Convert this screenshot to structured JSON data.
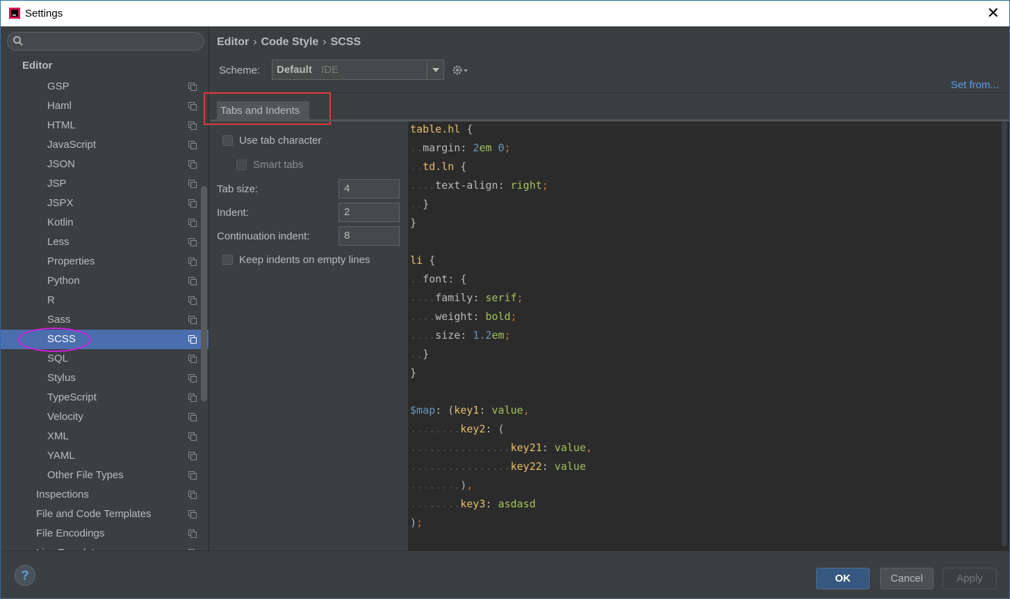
{
  "window": {
    "title": "Settings"
  },
  "sidebar": {
    "search_placeholder": "",
    "section": "Editor",
    "items": [
      {
        "label": "GSP",
        "level": 2
      },
      {
        "label": "Haml",
        "level": 2
      },
      {
        "label": "HTML",
        "level": 2
      },
      {
        "label": "JavaScript",
        "level": 2
      },
      {
        "label": "JSON",
        "level": 2
      },
      {
        "label": "JSP",
        "level": 2
      },
      {
        "label": "JSPX",
        "level": 2
      },
      {
        "label": "Kotlin",
        "level": 2
      },
      {
        "label": "Less",
        "level": 2
      },
      {
        "label": "Properties",
        "level": 2
      },
      {
        "label": "Python",
        "level": 2
      },
      {
        "label": "R",
        "level": 2
      },
      {
        "label": "Sass",
        "level": 2
      },
      {
        "label": "SCSS",
        "level": 2,
        "selected": true
      },
      {
        "label": "SQL",
        "level": 2
      },
      {
        "label": "Stylus",
        "level": 2
      },
      {
        "label": "TypeScript",
        "level": 2
      },
      {
        "label": "Velocity",
        "level": 2
      },
      {
        "label": "XML",
        "level": 2
      },
      {
        "label": "YAML",
        "level": 2
      },
      {
        "label": "Other File Types",
        "level": 2
      },
      {
        "label": "Inspections",
        "level": 1
      },
      {
        "label": "File and Code Templates",
        "level": 1
      },
      {
        "label": "File Encodings",
        "level": 1
      },
      {
        "label": "Live Templates",
        "level": 1
      }
    ]
  },
  "breadcrumb": [
    "Editor",
    "Code Style",
    "SCSS"
  ],
  "breadcrumb_sep": "›",
  "scheme": {
    "label": "Scheme:",
    "value": "Default",
    "sub": "IDE"
  },
  "set_from": "Set from...",
  "tabs": [
    "Tabs and Indents"
  ],
  "options": {
    "use_tab": "Use tab character",
    "smart_tabs": "Smart tabs",
    "tab_size_label": "Tab size:",
    "tab_size": "4",
    "indent_label": "Indent:",
    "indent": "2",
    "cont_indent_label": "Continuation indent:",
    "cont_indent": "8",
    "keep_indents": "Keep indents on empty lines"
  },
  "code_preview": [
    "table.hl {",
    "  margin: 2em 0;",
    "  td.ln {",
    "    text-align: right;",
    "  }",
    "}",
    "",
    "li {",
    "  font: {",
    "    family: serif;",
    "    weight: bold;",
    "    size: 1.2em;",
    "  }",
    "}",
    "",
    "$map: (key1: value,",
    "        key2: (",
    "                key21: value,",
    "                key22: value",
    "        ),",
    "        key3: asdasd",
    ");"
  ],
  "buttons": {
    "help": "?",
    "ok": "OK",
    "cancel": "Cancel",
    "apply": "Apply"
  },
  "colors": {
    "selection": "#4b6eaf",
    "link": "#589df6",
    "annotation_oval": "#d81be0",
    "annotation_rect": "#e33b3b"
  }
}
